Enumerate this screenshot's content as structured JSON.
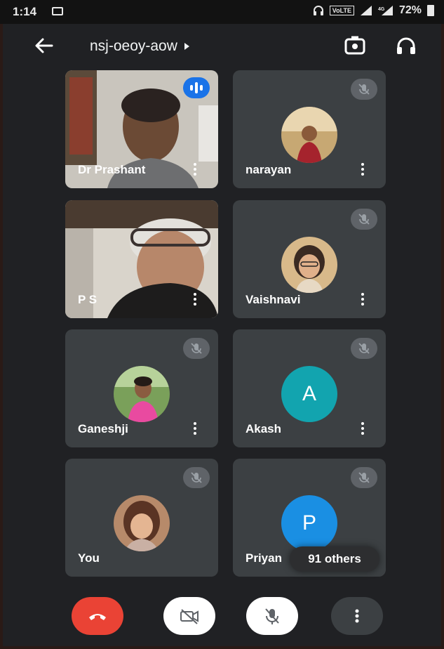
{
  "status_bar": {
    "time": "1:14",
    "network_badge": "VoLTE",
    "battery": "72%"
  },
  "header": {
    "meeting_code": "nsj-oeoy-aow",
    "icons": [
      "back-arrow-icon",
      "switch-camera-icon",
      "headphones-icon"
    ]
  },
  "participants": [
    {
      "name": "Dr Prashant",
      "type": "video",
      "speaking": true
    },
    {
      "name": "narayan",
      "type": "photo",
      "muted": true
    },
    {
      "name": "P S",
      "type": "video"
    },
    {
      "name": "Vaishnavi",
      "type": "photo",
      "muted": true
    },
    {
      "name": "Ganeshji",
      "type": "photo",
      "muted": true
    },
    {
      "name": "Akash",
      "type": "letter",
      "letter": "A",
      "color": "#12a4af",
      "muted": true
    },
    {
      "name": "You",
      "type": "photo",
      "muted": true
    },
    {
      "name": "Priyan",
      "type": "letter",
      "letter": "P",
      "color": "#1a8fe3",
      "muted": true
    }
  ],
  "others_badge": "91 others",
  "controls": {
    "end_call_color": "#ea4335",
    "icons": [
      "end-call-icon",
      "camera-off-icon",
      "mic-off-icon",
      "more-options-icon"
    ]
  }
}
